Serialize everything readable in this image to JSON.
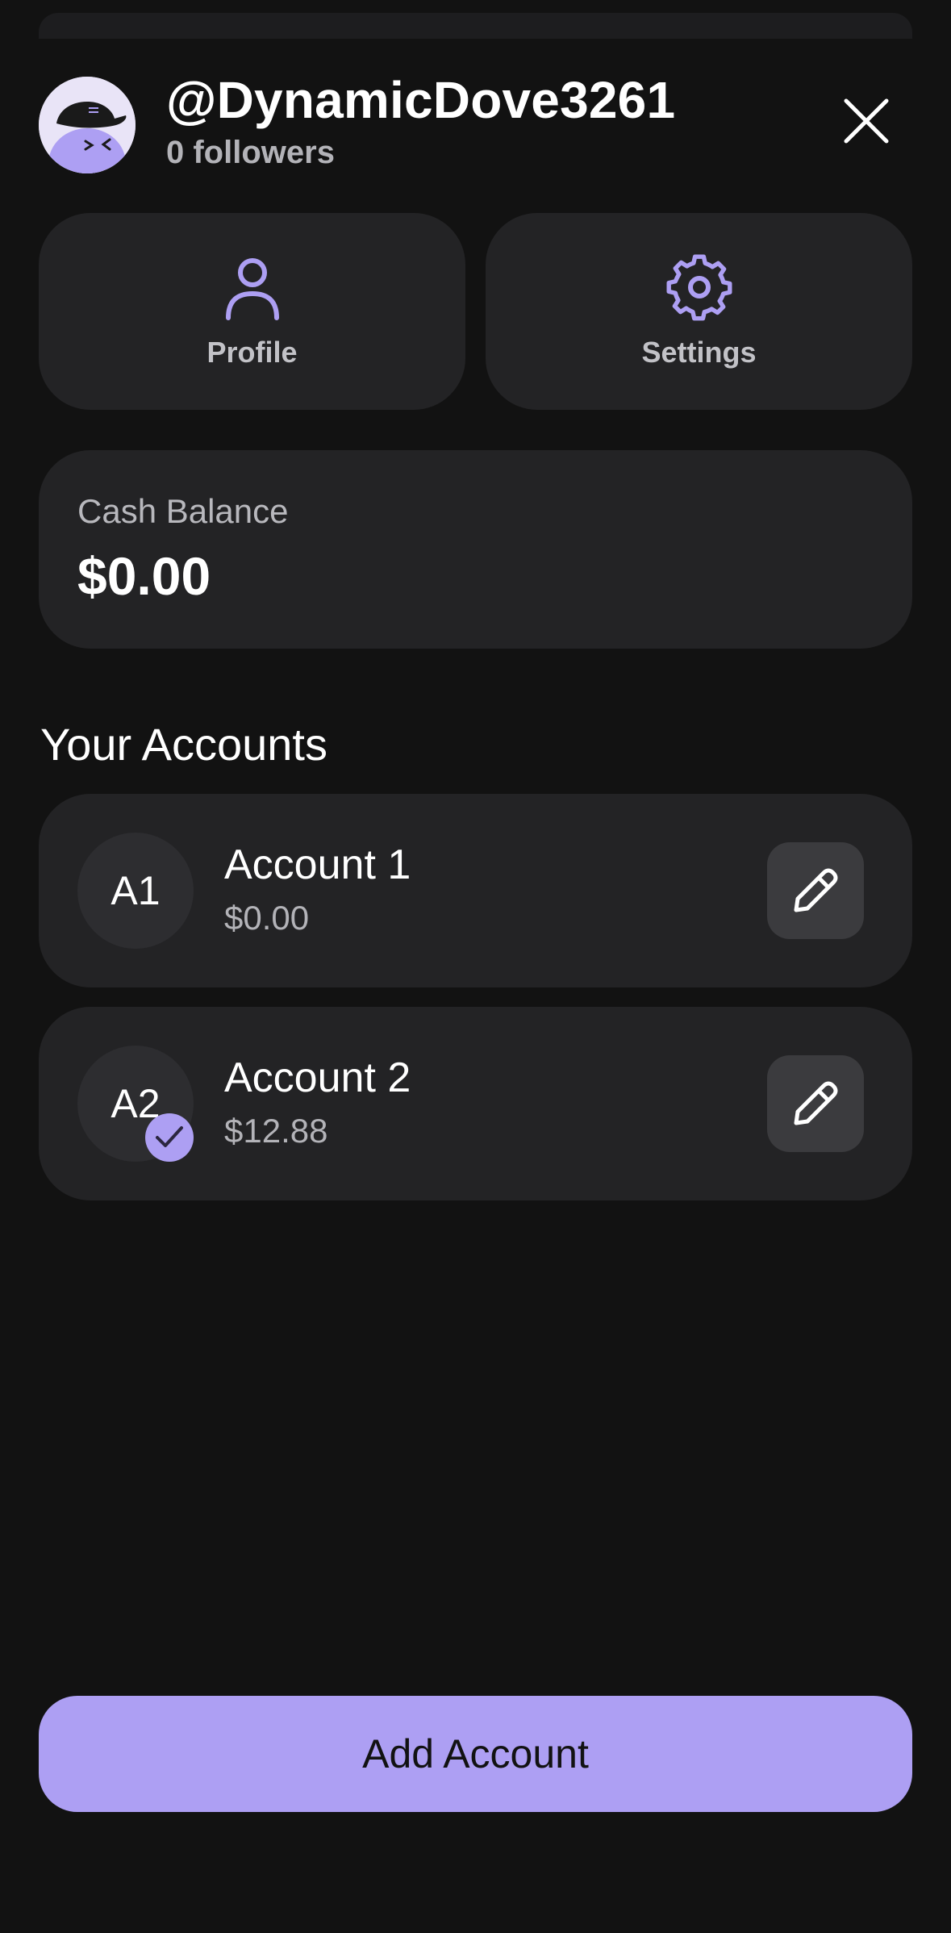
{
  "user": {
    "username": "@DynamicDove3261",
    "followers": "0 followers"
  },
  "tiles": {
    "profile_label": "Profile",
    "settings_label": "Settings"
  },
  "cash": {
    "label": "Cash Balance",
    "value": "$0.00"
  },
  "accounts_section": {
    "title": "Your Accounts",
    "items": [
      {
        "initials": "A1",
        "name": "Account 1",
        "amount": "$0.00",
        "selected": false
      },
      {
        "initials": "A2",
        "name": "Account 2",
        "amount": "$12.88",
        "selected": true
      }
    ]
  },
  "actions": {
    "add_account_label": "Add Account"
  },
  "colors": {
    "accent": "#ad9ff3",
    "background": "#121212",
    "card": "#232325"
  },
  "icons": {
    "close": "close-icon",
    "profile": "person-icon",
    "settings": "gear-icon",
    "edit": "pencil-icon",
    "selected": "check-icon"
  }
}
